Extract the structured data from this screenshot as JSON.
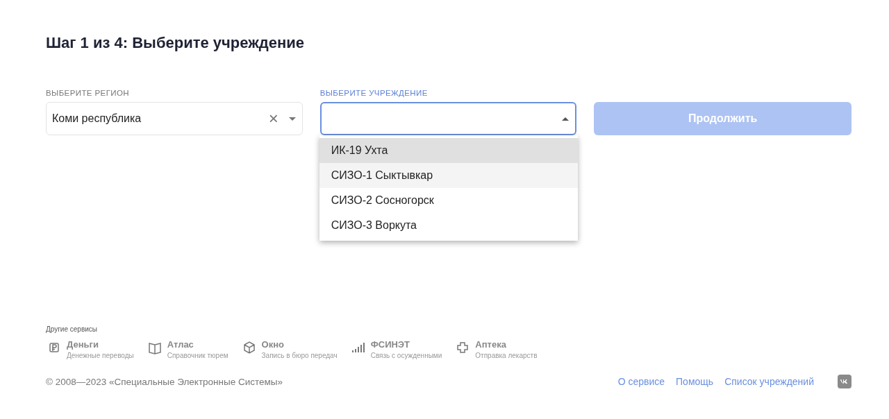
{
  "title": "Шаг 1 из 4: Выберите учреждение",
  "region": {
    "label": "ВЫБЕРИТЕ РЕГИОН",
    "value": "Коми республика",
    "clear_icon": "×"
  },
  "institution": {
    "label": "ВЫБЕРИТЕ УЧРЕЖДЕНИЕ",
    "focused": true,
    "expanded": true,
    "options": [
      {
        "label": "ИК-19 Ухта",
        "selected": true,
        "hovered": false
      },
      {
        "label": "СИЗО-1 Сыктывкар",
        "selected": false,
        "hovered": true
      },
      {
        "label": "СИЗО-2 Сосногорск",
        "selected": false,
        "hovered": false
      },
      {
        "label": "СИЗО-3 Воркута",
        "selected": false,
        "hovered": false
      }
    ]
  },
  "continue_button": {
    "label": "Продолжить",
    "disabled": true
  },
  "footer": {
    "services_title": "Другие сервисы",
    "services": [
      {
        "kind": "money",
        "name": "Деньги",
        "description": "Денежные переводы"
      },
      {
        "kind": "atlas",
        "name": "Атлас",
        "description": "Справочник тюрем"
      },
      {
        "kind": "box",
        "name": "Окно",
        "description": "Запись в бюро передач"
      },
      {
        "kind": "signal",
        "name": "ФСИНЭТ",
        "description": "Связь с осужденными"
      },
      {
        "kind": "pharmacy",
        "name": "Аптека",
        "description": "Отправка лекарств"
      }
    ],
    "copyright": "© 2008—2023 «Специальные Электронные Системы»",
    "links": [
      "О сервисе",
      "Помощь",
      "Список учреждений"
    ]
  }
}
